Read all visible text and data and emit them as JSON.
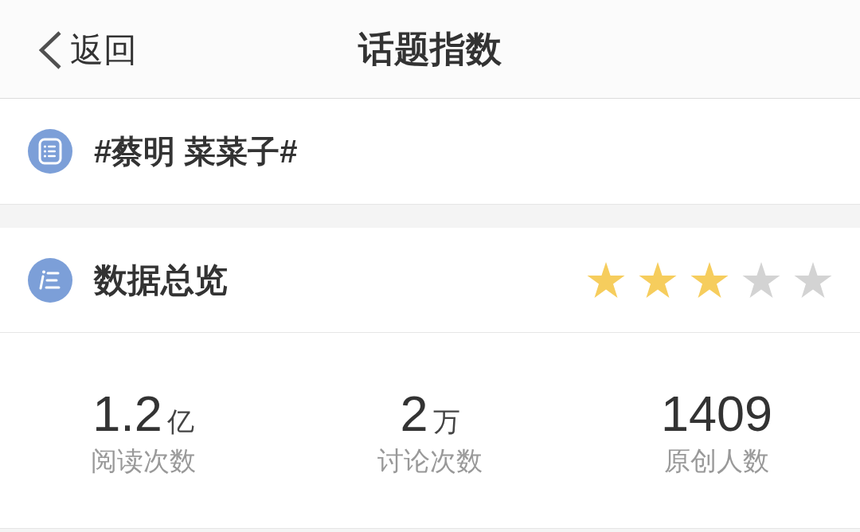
{
  "nav": {
    "back": "返回",
    "title": "话题指数"
  },
  "topic": {
    "title": "#蔡明 菜菜子#"
  },
  "overview": {
    "title": "数据总览",
    "stars": 3
  },
  "stats": [
    {
      "value": "1.2",
      "unit": "亿",
      "label": "阅读次数"
    },
    {
      "value": "2",
      "unit": "万",
      "label": "讨论次数"
    },
    {
      "value": "1409",
      "label": "原创人数"
    }
  ]
}
